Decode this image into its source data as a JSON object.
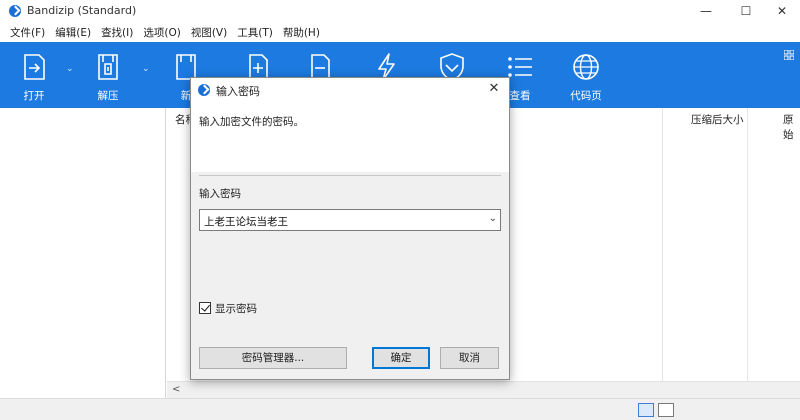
{
  "window": {
    "title": "Bandizip (Standard)"
  },
  "menu": [
    "文件(F)",
    "编辑(E)",
    "查找(I)",
    "选项(O)",
    "视图(V)",
    "工具(T)",
    "帮助(H)"
  ],
  "ribbon": {
    "buttons": [
      {
        "label": "打开",
        "icon": "open-icon"
      },
      {
        "label": "解压",
        "icon": "extract-icon"
      },
      {
        "label": "新",
        "icon": "new-archive-icon"
      },
      {
        "label": "",
        "icon": "add-file-icon"
      },
      {
        "label": "",
        "icon": "delete-file-icon"
      },
      {
        "label": "",
        "icon": "lightning-icon"
      },
      {
        "label": "",
        "icon": "shield-icon"
      },
      {
        "label": "查看",
        "icon": "list-view-icon"
      },
      {
        "label": "代码页",
        "icon": "globe-icon"
      }
    ]
  },
  "columns": {
    "name": "名称",
    "compressed_size": "压缩后大小",
    "original": "原始"
  },
  "scroll": {
    "left_arrow": "<"
  },
  "dialog": {
    "title": "输入密码",
    "instruction": "输入加密文件的密码。",
    "password_label": "输入密码",
    "password_value": "上老王论坛当老王",
    "show_password_label": "显示密码",
    "show_password_checked": true,
    "manager_button": "密码管理器...",
    "ok_button": "确定",
    "cancel_button": "取消"
  },
  "colors": {
    "ribbon": "#1c7ae0",
    "accent": "#0078d7"
  }
}
